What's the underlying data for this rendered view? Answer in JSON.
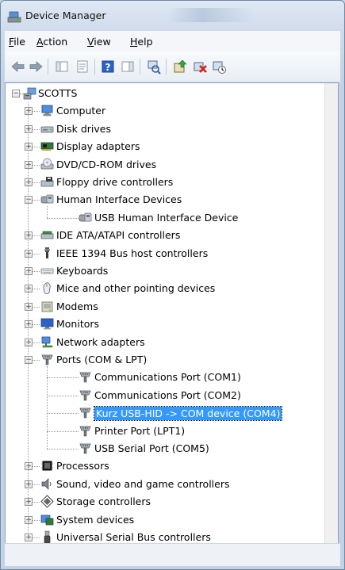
{
  "window": {
    "title": "Device Manager"
  },
  "menubar": {
    "items": [
      {
        "accel": "F",
        "rest": "ile"
      },
      {
        "accel": "A",
        "rest": "ction"
      },
      {
        "accel": "V",
        "rest": "iew"
      },
      {
        "accel": "H",
        "rest": "elp"
      }
    ]
  },
  "toolbar": {
    "buttons": [
      "back-icon",
      "forward-icon",
      "console-tree-icon",
      "properties-icon",
      "help-icon",
      "action-pane-icon",
      "scan-hardware-icon",
      "update-driver-icon",
      "uninstall-icon",
      "disable-icon"
    ]
  },
  "tree": {
    "root": "SCOTTS",
    "items": [
      {
        "label": "Computer",
        "icon": "computer-icon",
        "state": "collapsed"
      },
      {
        "label": "Disk drives",
        "icon": "disk-drive-icon",
        "state": "collapsed"
      },
      {
        "label": "Display adapters",
        "icon": "display-adapter-icon",
        "state": "collapsed"
      },
      {
        "label": "DVD/CD-ROM drives",
        "icon": "dvd-drive-icon",
        "state": "collapsed"
      },
      {
        "label": "Floppy drive controllers",
        "icon": "floppy-controller-icon",
        "state": "collapsed"
      },
      {
        "label": "Human Interface Devices",
        "icon": "hid-icon",
        "state": "expanded",
        "children": [
          {
            "label": "USB Human Interface Device",
            "icon": "hid-icon"
          }
        ]
      },
      {
        "label": "IDE ATA/ATAPI controllers",
        "icon": "ide-controller-icon",
        "state": "collapsed"
      },
      {
        "label": "IEEE 1394 Bus host controllers",
        "icon": "ieee1394-icon",
        "state": "collapsed"
      },
      {
        "label": "Keyboards",
        "icon": "keyboard-icon",
        "state": "collapsed"
      },
      {
        "label": "Mice and other pointing devices",
        "icon": "mouse-icon",
        "state": "collapsed"
      },
      {
        "label": "Modems",
        "icon": "modem-icon",
        "state": "collapsed"
      },
      {
        "label": "Monitors",
        "icon": "monitor-icon",
        "state": "collapsed"
      },
      {
        "label": "Network adapters",
        "icon": "network-adapter-icon",
        "state": "collapsed"
      },
      {
        "label": "Ports (COM & LPT)",
        "icon": "port-icon",
        "state": "expanded",
        "children": [
          {
            "label": "Communications Port (COM1)",
            "icon": "port-icon"
          },
          {
            "label": "Communications Port (COM2)",
            "icon": "port-icon"
          },
          {
            "label": "Kurz USB-HID -> COM device (COM4)",
            "icon": "port-icon",
            "selected": true
          },
          {
            "label": "Printer Port (LPT1)",
            "icon": "port-icon"
          },
          {
            "label": "USB Serial Port (COM5)",
            "icon": "port-icon"
          }
        ]
      },
      {
        "label": "Processors",
        "icon": "processor-icon",
        "state": "collapsed"
      },
      {
        "label": "Sound, video and game controllers",
        "icon": "sound-icon",
        "state": "collapsed"
      },
      {
        "label": "Storage controllers",
        "icon": "storage-controller-icon",
        "state": "collapsed"
      },
      {
        "label": "System devices",
        "icon": "system-devices-icon",
        "state": "collapsed"
      },
      {
        "label": "Universal Serial Bus controllers",
        "icon": "usb-controller-icon",
        "state": "collapsed"
      }
    ]
  },
  "colors": {
    "selection": "#3399ff",
    "title_gradient_top": "#dfe9f5",
    "pane_border": "#8da2bb"
  }
}
